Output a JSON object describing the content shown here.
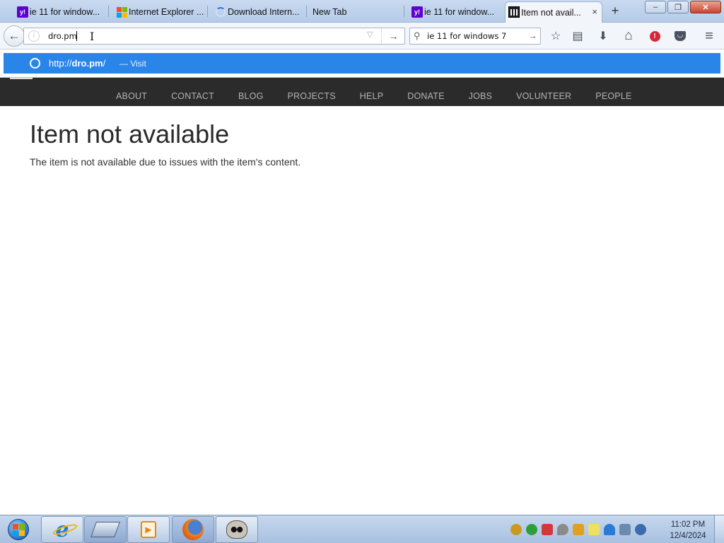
{
  "tabs": [
    {
      "title": "ie 11 for window...",
      "favicon": "yahoo-icon",
      "active": false
    },
    {
      "title": "Internet Explorer ...",
      "favicon": "microsoft-logo-icon",
      "active": false
    },
    {
      "title": "Download Intern...",
      "favicon": "loading-spinner-icon",
      "active": false
    },
    {
      "title": "New Tab",
      "favicon": "",
      "active": false
    },
    {
      "title": "ie 11 for window...",
      "favicon": "yahoo-icon",
      "active": false
    },
    {
      "title": "Item not avail...",
      "favicon": "internet-archive-icon",
      "active": true
    }
  ],
  "tab_close_glyph": "×",
  "new_tab_glyph": "+",
  "window_controls": {
    "minimize": "–",
    "maximize": "❐",
    "close": "✕"
  },
  "navbar": {
    "back_glyph": "←",
    "url_value": "dro.pm",
    "url_dropdown_glyph": "▽",
    "go_glyph": "→",
    "search_value": "ie 11 for windows 7",
    "search_go_glyph": "→",
    "tools": [
      {
        "name": "bookmark-star-icon",
        "glyph": "☆"
      },
      {
        "name": "reader-list-icon",
        "glyph": "▤"
      },
      {
        "name": "download-icon",
        "glyph": "⬇"
      },
      {
        "name": "home-icon",
        "glyph": "⌂"
      },
      {
        "name": "notification-icon",
        "glyph": "!"
      },
      {
        "name": "pocket-icon",
        "glyph": "◡"
      },
      {
        "name": "menu-icon",
        "glyph": "≡"
      }
    ]
  },
  "autocomplete": {
    "url_prefix": "http://",
    "url_bold": "dro.pm",
    "url_suffix": "/",
    "action": "— Visit"
  },
  "site_nav": [
    "ABOUT",
    "CONTACT",
    "BLOG",
    "PROJECTS",
    "HELP",
    "DONATE",
    "JOBS",
    "VOLUNTEER",
    "PEOPLE"
  ],
  "page": {
    "title": "Item not available",
    "message": "The item is not available due to issues with the item's content."
  },
  "taskbar": {
    "pinned": [
      "internet-explorer-icon",
      "removable-disk-icon",
      "media-player-icon",
      "firefox-icon",
      "raccoon-app-icon"
    ],
    "tray_colors": [
      "#c89a1e",
      "#2e9e3a",
      "#d2383a",
      "#8a8a8a",
      "#e0a020",
      "#f0e060",
      "#2a7ad6",
      "#6a8ab0",
      "#3a6ab0"
    ],
    "time": "11:02 PM",
    "date": "12/4/2024"
  },
  "colors": {
    "autocomplete_highlight": "#2a85e8",
    "site_nav_bg": "#2b2b2b",
    "yahoo_purple": "#5f01d1"
  }
}
